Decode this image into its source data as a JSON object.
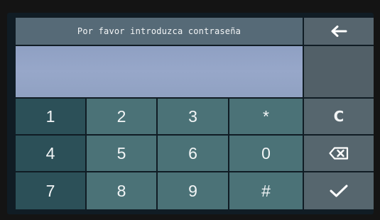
{
  "header": {
    "prompt": "Por favor introduzca contraseña"
  },
  "password": {
    "value": ""
  },
  "keypad": {
    "rows": [
      [
        "1",
        "2",
        "3",
        "*"
      ],
      [
        "4",
        "5",
        "6",
        "0"
      ],
      [
        "7",
        "8",
        "9",
        "#"
      ]
    ]
  },
  "functions": {
    "clear_label": "C",
    "back_icon": "arrow-left-icon",
    "delete_icon": "backspace-icon",
    "confirm_icon": "checkmark-icon"
  },
  "colors": {
    "key_dark": "#2c5058",
    "key_light": "#4b7277",
    "header_bg": "#566a77",
    "field_bg": "#97a7c9",
    "function_bg": "#56666e"
  }
}
